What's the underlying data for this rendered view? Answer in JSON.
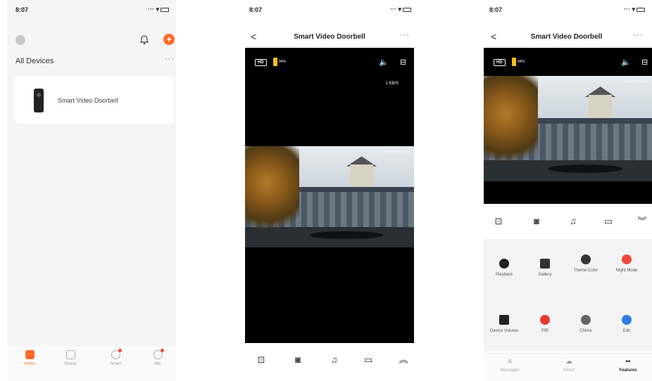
{
  "screen1": {
    "status_time": "8:07",
    "section_title": "All Devices",
    "more": "···",
    "device_name": "Smart Video Doorbell",
    "tabs": [
      {
        "label": "Home"
      },
      {
        "label": "Scene"
      },
      {
        "label": "Smart"
      },
      {
        "label": "Me"
      }
    ]
  },
  "screen2": {
    "status_time": "8:07",
    "back": "<",
    "title": "Smart Video Doorbell",
    "more": "···",
    "quality": "HD",
    "battery_pct": "94%",
    "bitrate": "1 KB/S",
    "timestamp": "10/11/2022 15:32:45"
  },
  "screen3": {
    "status_time": "8:07",
    "back": "<",
    "title": "Smart Video Doorbell",
    "more": "···",
    "quality": "HD",
    "battery_pct": "94%",
    "timestamp": "10/11/2022 15:32:45",
    "features": [
      {
        "label": "Playback",
        "color": "#222222"
      },
      {
        "label": "Gallery",
        "color": "#333333"
      },
      {
        "label": "Theme Color",
        "color": "#333333"
      },
      {
        "label": "Night Mode",
        "color": "#f24a3d"
      },
      {
        "label": "Device Volume",
        "color": "#222222"
      },
      {
        "label": "PIR",
        "color": "#e53935"
      },
      {
        "label": "Chime",
        "color": "#666666"
      },
      {
        "label": "Edit",
        "color": "#2f7de1"
      }
    ],
    "tabs": [
      {
        "label": "Messages"
      },
      {
        "label": "Cloud"
      },
      {
        "label": "Features"
      }
    ]
  },
  "colors": {
    "accent": "#ff6a2a",
    "notification": "#f24a3d"
  }
}
